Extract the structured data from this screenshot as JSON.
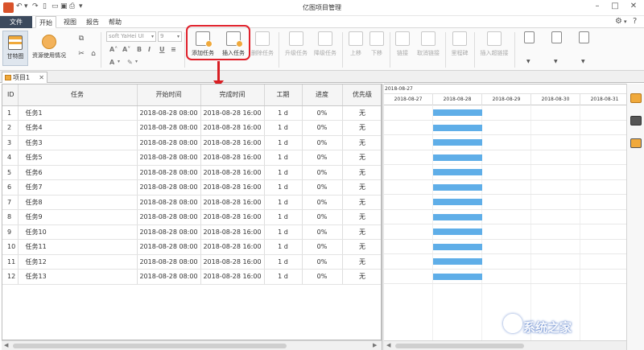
{
  "window": {
    "title": "亿图项目管理"
  },
  "menu": {
    "file": "文件",
    "tabs": [
      "开始",
      "视图",
      "报告",
      "帮助"
    ]
  },
  "ribbon": {
    "gantt": "甘特图",
    "resource_usage": "资源使用情况",
    "font_name": "soft YaHei UI",
    "font_size": "9",
    "add_task": "添加任务",
    "insert_task": "插入任务",
    "delete_task": "删除任务",
    "upgrade_task": "升级任务",
    "downgrade_task": "降级任务",
    "move_up": "上移",
    "move_down": "下移",
    "link": "链接",
    "unlink": "取消链接",
    "milestone": "里程碑",
    "insert_hyperlink": "插入超链接"
  },
  "doc_tab": {
    "label": "项目1"
  },
  "table": {
    "columns": [
      "ID",
      "任务",
      "开始时间",
      "完成时间",
      "工期",
      "进度",
      "优先级"
    ],
    "rows": [
      [
        "1",
        "任务1",
        "2018-08-28 08:00",
        "2018-08-28 16:00",
        "1 d",
        "0%",
        "无"
      ],
      [
        "2",
        "任务4",
        "2018-08-28 08:00",
        "2018-08-28 16:00",
        "1 d",
        "0%",
        "无"
      ],
      [
        "3",
        "任务3",
        "2018-08-28 08:00",
        "2018-08-28 16:00",
        "1 d",
        "0%",
        "无"
      ],
      [
        "4",
        "任务5",
        "2018-08-28 08:00",
        "2018-08-28 16:00",
        "1 d",
        "0%",
        "无"
      ],
      [
        "5",
        "任务6",
        "2018-08-28 08:00",
        "2018-08-28 16:00",
        "1 d",
        "0%",
        "无"
      ],
      [
        "6",
        "任务7",
        "2018-08-28 08:00",
        "2018-08-28 16:00",
        "1 d",
        "0%",
        "无"
      ],
      [
        "7",
        "任务8",
        "2018-08-28 08:00",
        "2018-08-28 16:00",
        "1 d",
        "0%",
        "无"
      ],
      [
        "8",
        "任务9",
        "2018-08-28 08:00",
        "2018-08-28 16:00",
        "1 d",
        "0%",
        "无"
      ],
      [
        "9",
        "任务10",
        "2018-08-28 08:00",
        "2018-08-28 16:00",
        "1 d",
        "0%",
        "无"
      ],
      [
        "10",
        "任务11",
        "2018-08-28 08:00",
        "2018-08-28 16:00",
        "1 d",
        "0%",
        "无"
      ],
      [
        "11",
        "任务12",
        "2018-08-28 08:00",
        "2018-08-28 16:00",
        "1 d",
        "0%",
        "无"
      ],
      [
        "12",
        "任务13",
        "2018-08-28 08:00",
        "2018-08-28 16:00",
        "1 d",
        "0%",
        "无"
      ]
    ]
  },
  "gantt": {
    "month_label": "2018-08-27",
    "days": [
      "2018-08-27",
      "2018-08-28",
      "2018-08-29",
      "2018-08-30",
      "2018-08-31"
    ],
    "bar_day": "2018-08-28",
    "bar_color": "#5faee8"
  },
  "watermark": {
    "text": "系统之家"
  },
  "colors": {
    "file_tab": "#3c4a5d",
    "highlight": "#e0202a",
    "accent": "#f0a93b"
  }
}
